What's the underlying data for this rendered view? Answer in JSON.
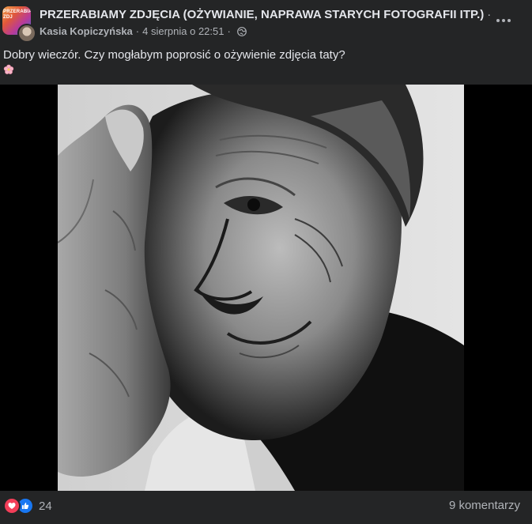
{
  "post": {
    "group_name": "PRZERABIAMY ZDJĘCIA (OŻYWIANIE, NAPRAWA STARYCH FOTOGRAFII ITP.)",
    "group_name_suffix": "·",
    "group_avatar_text": "PRZERABIAMY ZDJ",
    "author": "Kasia Kopiczyńska",
    "separator": "·",
    "timestamp": "4 sierpnia o 22:51",
    "separator2": "·",
    "privacy_icon": "globe-icon",
    "text": "Dobry wieczór. Czy mogłabym poprosić o ożywienie zdjęcia taty?",
    "emoji_icon": "cherry-blossom-icon"
  },
  "footer": {
    "reaction_icons": [
      "love-icon",
      "like-icon"
    ],
    "reaction_count": "24",
    "comments_label": "9 komentarzy"
  },
  "colors": {
    "background": "#242526",
    "text_primary": "#e4e6eb",
    "text_secondary": "#b0b3b8",
    "love": "#f33e58",
    "like": "#1877f2"
  }
}
